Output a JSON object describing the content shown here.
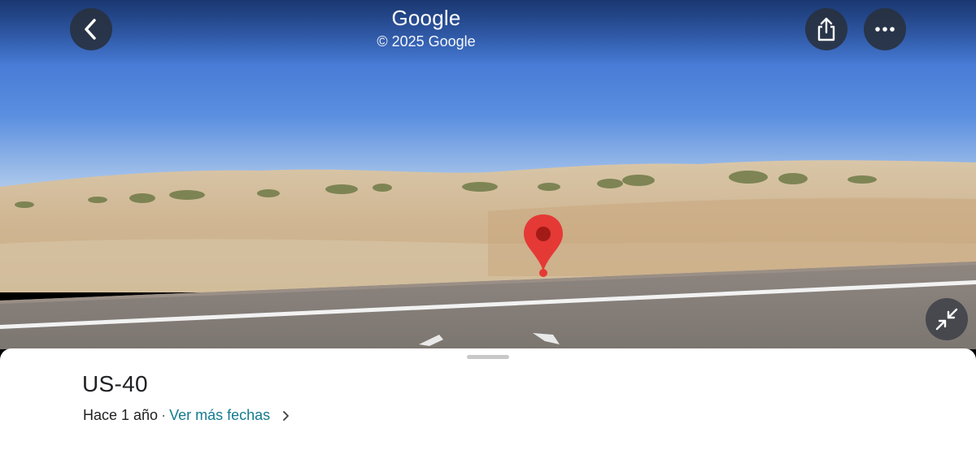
{
  "header": {
    "title": "Google",
    "copyright": "© 2025 Google"
  },
  "icons": {
    "back": "chevron-left-icon",
    "share": "share-icon",
    "more": "more-horizontal-icon",
    "collapse": "collapse-arrows-icon",
    "pin": "map-pin-icon"
  },
  "sheet": {
    "place_name": "US-40",
    "date_text": "Hace 1 año",
    "separator": "·",
    "more_dates_link": "Ver más fechas"
  },
  "colors": {
    "pin": "#e53935",
    "link": "#137b8f"
  }
}
